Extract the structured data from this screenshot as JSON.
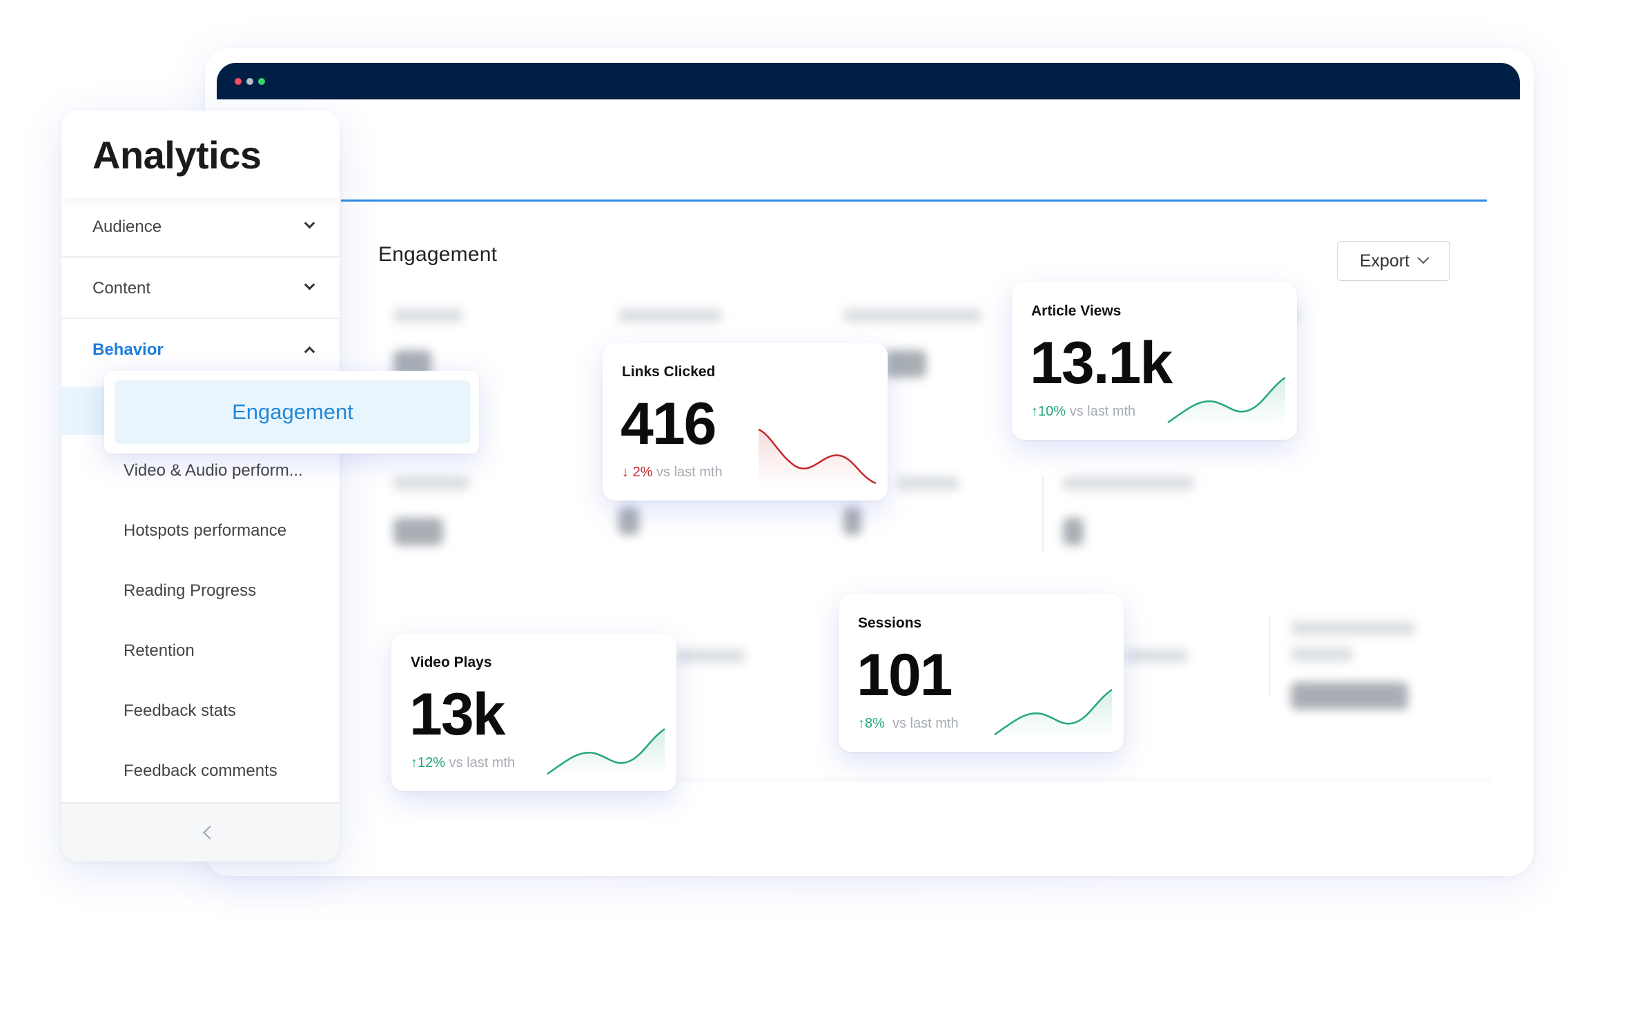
{
  "window": {
    "controls": [
      "close",
      "minimize",
      "maximize"
    ]
  },
  "sidebar": {
    "title": "Analytics",
    "sections": [
      {
        "label": "Audience",
        "expanded": false
      },
      {
        "label": "Content",
        "expanded": false
      },
      {
        "label": "Behavior",
        "expanded": true
      }
    ],
    "items": [
      "Engagement",
      "Video & Audio perform...",
      "Hotspots performance",
      "Reading Progress",
      "Retention",
      "Feedback stats",
      "Feedback comments"
    ],
    "selected_item": "Engagement",
    "collapse_icon": "chevron-left-icon"
  },
  "main": {
    "section_title": "Engagement",
    "export_label": "Export",
    "cards": [
      {
        "label": "Links Clicked",
        "value": "416",
        "direction": "down",
        "pct": "2%",
        "suffix": " vs last mth",
        "color": "#c6262e"
      },
      {
        "label": "Article Views",
        "value": "13.1k",
        "direction": "up",
        "pct": "10%",
        "suffix": " vs last mth",
        "color": "#24a67b"
      },
      {
        "label": "Video Plays",
        "value": "13k",
        "direction": "up",
        "pct": "12%",
        "suffix": " vs last mth",
        "color": "#24a67b"
      },
      {
        "label": "Sessions",
        "value": "101",
        "direction": "up",
        "pct": "8%",
        "suffix": "  vs last mth",
        "color": "#24a67b"
      }
    ]
  },
  "colors": {
    "titlebar": "#001f45",
    "accent": "#2388d8",
    "positive": "#24a67b",
    "negative": "#c6262e"
  }
}
